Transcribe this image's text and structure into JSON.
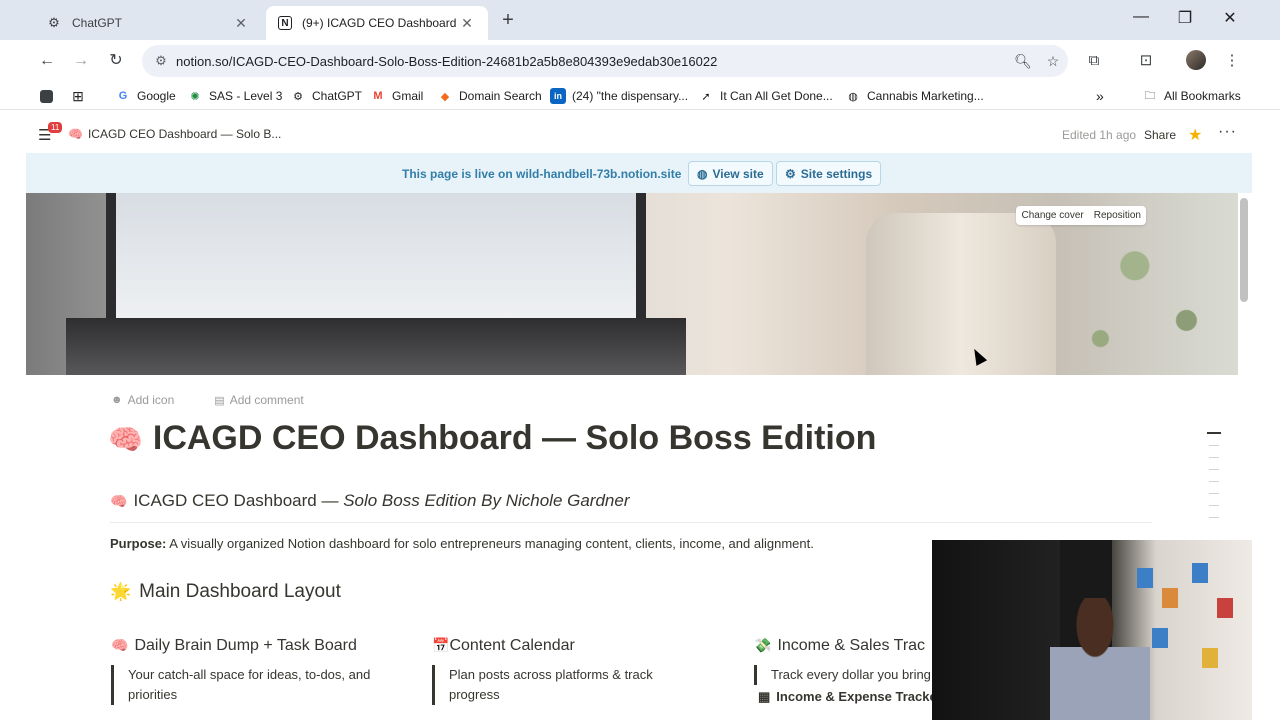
{
  "browser": {
    "tabs": [
      {
        "title": "ChatGPT",
        "active": false
      },
      {
        "title": "(9+) ICAGD CEO Dashboard —",
        "active": true
      }
    ],
    "url": "notion.so/ICAGD-CEO-Dashboard-Solo-Boss-Edition-24681b2a5b8e804393e9edab30e16022",
    "bookmarks": [
      {
        "label": "Google",
        "icon": "google-icon"
      },
      {
        "label": "SAS - Level 3",
        "icon": "globe-icon"
      },
      {
        "label": "ChatGPT",
        "icon": "openai-icon"
      },
      {
        "label": "Gmail",
        "icon": "gmail-icon"
      },
      {
        "label": "Domain Search",
        "icon": "domain-icon"
      },
      {
        "label": "(24) \"the dispensary...",
        "icon": "linkedin-icon"
      },
      {
        "label": "It Can All Get Done...",
        "icon": "rocket-icon"
      },
      {
        "label": "Cannabis Marketing...",
        "icon": "globe-icon"
      }
    ],
    "all_bookmarks": "All Bookmarks"
  },
  "notion": {
    "badge": "11",
    "breadcrumb": "ICAGD CEO Dashboard — Solo B...",
    "edited": "Edited 1h ago",
    "share": "Share",
    "live_message": "This page is live on wild-handbell-73b.notion.site",
    "view_site": "View site",
    "site_settings": "Site settings",
    "change_cover": "Change cover",
    "reposition": "Reposition",
    "add_icon": "Add icon",
    "add_comment": "Add comment",
    "title_emoji": "🧠",
    "title": "ICAGD CEO Dashboard — Solo Boss Edition",
    "heading_emoji": "🧠",
    "heading_plain": "ICAGD CEO Dashboard — ",
    "heading_italic": "Solo Boss Edition By Nichole Gardner",
    "purpose_label": "Purpose:",
    "purpose_text": " A visually organized Notion dashboard for solo entrepreneurs managing content, clients, income, and alignment.",
    "section_emoji": "🌟",
    "section_title": "Main Dashboard Layout",
    "columns": [
      {
        "emoji": "🧠",
        "title": "Daily Brain Dump + Task Board",
        "desc": "Your catch-all space for ideas, to-dos, and priorities",
        "sub": ""
      },
      {
        "emoji": "📅",
        "title": "Content Calendar",
        "desc": "Plan posts across platforms & track progress",
        "sub": ""
      },
      {
        "emoji": "💸",
        "title": "Income & Sales Trac",
        "desc": "Track every dollar you bring",
        "sub": "Income & Expense Tracke"
      }
    ]
  }
}
